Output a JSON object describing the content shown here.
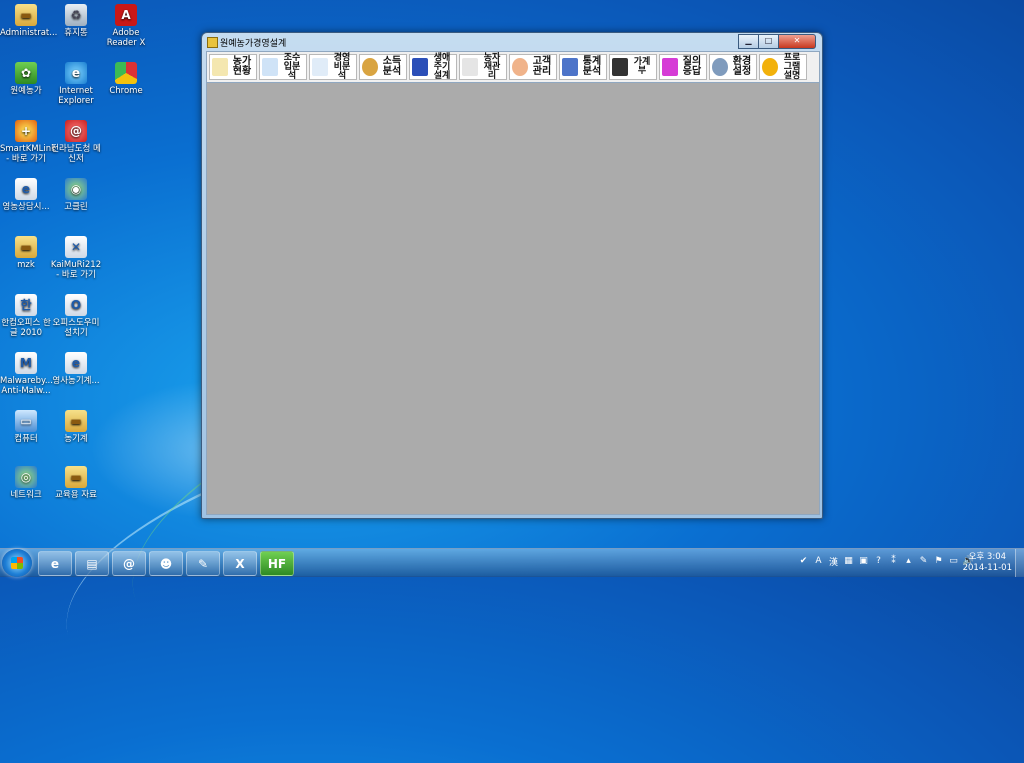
{
  "desktop": {
    "icons": [
      {
        "label": "Administrat...",
        "icon": "folder-icon"
      },
      {
        "label": "휴지통",
        "icon": "recycle-bin-icon"
      },
      {
        "label": "Adobe Reader X",
        "icon": "pdf-icon"
      },
      {
        "label": "원예농가",
        "icon": "app-icon"
      },
      {
        "label": "Internet Explorer",
        "icon": "ie-icon"
      },
      {
        "label": "Chrome",
        "icon": "chrome-icon"
      },
      {
        "label": "SmartKMLink - 바로 가기",
        "icon": "smartkm-icon"
      },
      {
        "label": "전라남도청 메신저",
        "icon": "messenger-icon"
      },
      {
        "label": "영농상담시...",
        "icon": "shortcut-icon"
      },
      {
        "label": "고클린",
        "icon": "goclean-icon"
      },
      {
        "label": "mzk",
        "icon": "folder-icon"
      },
      {
        "label": "KaiMuRi212 - 바로 가기",
        "icon": "kaimuri-icon"
      },
      {
        "label": "한컴오피스 한글 2010",
        "icon": "hwp-icon"
      },
      {
        "label": "오피스도우미 설치기",
        "icon": "office-icon"
      },
      {
        "label": "Malwareby... Anti-Malw...",
        "icon": "malwarebytes-icon"
      },
      {
        "label": "영사농기계...",
        "icon": "shortcut-icon"
      },
      {
        "label": "컴퓨터",
        "icon": "computer-icon"
      },
      {
        "label": "농기계",
        "icon": "folder-icon"
      },
      {
        "label": "네트워크",
        "icon": "network-icon"
      },
      {
        "label": "교육용 자료",
        "icon": "folder-icon"
      }
    ]
  },
  "window": {
    "title": "원예농가경영설계",
    "minimize": "▁",
    "maximize": "□",
    "close": "✕"
  },
  "toolbar": {
    "buttons": [
      {
        "label": "농가현황",
        "icon": "farm-icon",
        "color": "#f4e7b0"
      },
      {
        "label": "조수입분석",
        "icon": "chart-icon",
        "color": "#cfe3f7"
      },
      {
        "label": "경영비분석",
        "icon": "pen-icon",
        "color": "#e0ecf8"
      },
      {
        "label": "소득분석",
        "icon": "money-bag-icon",
        "color": "#d9a441"
      },
      {
        "label": "생애주기설계",
        "icon": "lifecycle-icon",
        "color": "#2b4fb8"
      },
      {
        "label": "농자재관리",
        "icon": "shovel-icon",
        "color": "#e5e5e5"
      },
      {
        "label": "고객관리",
        "icon": "customer-icon",
        "color": "#f0b38a"
      },
      {
        "label": "통계분석",
        "icon": "books-icon",
        "color": "#4d74c9"
      },
      {
        "label": "가계부",
        "icon": "notebook-icon",
        "color": "#333333"
      },
      {
        "label": "질의응답",
        "icon": "qa-icon",
        "color": "#d63cd6"
      },
      {
        "label": "환경설정",
        "icon": "gear-icon",
        "color": "#7f9bbd"
      },
      {
        "label": "프로그램설명",
        "icon": "help-icon",
        "color": "#f2b10b"
      }
    ]
  },
  "taskbar": {
    "apps": [
      {
        "name": "ie-taskbar-icon",
        "glyph": "e"
      },
      {
        "name": "explorer-taskbar-icon",
        "glyph": "▤"
      },
      {
        "name": "messenger-taskbar-icon",
        "glyph": "@"
      },
      {
        "name": "penguin-taskbar-icon",
        "glyph": "☻"
      },
      {
        "name": "shortcut-taskbar-icon",
        "glyph": "✎"
      },
      {
        "name": "excel-taskbar-icon",
        "glyph": "X"
      },
      {
        "name": "hf-taskbar-icon",
        "glyph": "HF"
      }
    ],
    "tray_glyphs": [
      "✔",
      "A",
      "漢",
      "▦",
      "▣",
      "?",
      "⁑",
      "▴",
      "✎",
      "⚑",
      "▭",
      "🔊"
    ],
    "clock_time": "오후 3:04",
    "clock_date": "2014-11-01"
  }
}
